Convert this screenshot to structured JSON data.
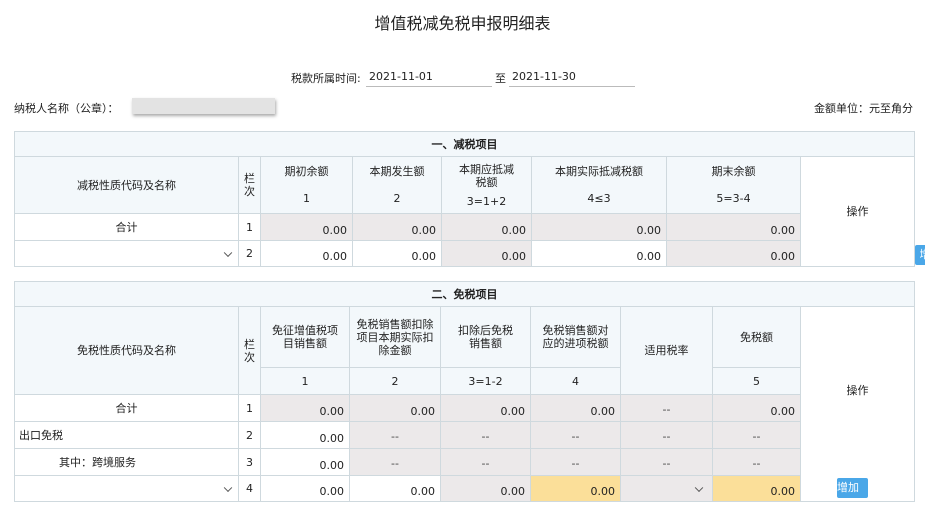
{
  "title": "增值税减免税申报明细表",
  "period": {
    "label": "税款所属时间:",
    "from": "2021-11-01",
    "to_label": "至",
    "to": "2021-11-30"
  },
  "taxpayer_label": "纳税人名称（公章）：",
  "unit": "金额单位：元至角分",
  "section1": {
    "title": "一、减税项目",
    "col_name": "减税性质代码及名称",
    "col_row": "栏次",
    "cols": [
      {
        "label": "期初余额",
        "formula": "1"
      },
      {
        "label": "本期发生额",
        "formula": "2"
      },
      {
        "label": "本期应抵减税额",
        "formula": "3=1+2"
      },
      {
        "label": "本期实际抵减税额",
        "formula": "4≤3"
      },
      {
        "label": "期末余额",
        "formula": "5=3-4"
      }
    ],
    "col_op": "操作",
    "rows": [
      {
        "name": "合计",
        "no": "1",
        "v": [
          "0.00",
          "0.00",
          "0.00",
          "0.00",
          "0.00"
        ]
      },
      {
        "name": "",
        "no": "2",
        "v": [
          "0.00",
          "0.00",
          "0.00",
          "0.00",
          "0.00"
        ]
      }
    ],
    "add_btn": "增加"
  },
  "section2": {
    "title": "二、免税项目",
    "col_name": "免税性质代码及名称",
    "col_row": "栏次",
    "cols": [
      {
        "label": "免征增值税项目销售额",
        "formula": "1"
      },
      {
        "label": "免税销售额扣除项目本期实际扣除金额",
        "formula": "2"
      },
      {
        "label": "扣除后免税销售额",
        "formula": "3=1-2"
      },
      {
        "label": "免税销售额对应的进项税额",
        "formula": "4"
      },
      {
        "label": "适用税率",
        "formula": ""
      },
      {
        "label": "免税额",
        "formula": "5"
      }
    ],
    "col_op": "操作",
    "rows": [
      {
        "name": "合计",
        "no": "1",
        "v": [
          "0.00",
          "0.00",
          "0.00",
          "0.00",
          "--",
          "0.00"
        ]
      },
      {
        "name": "出口免税",
        "no": "2",
        "v": [
          "0.00",
          "--",
          "--",
          "--",
          "--",
          "--"
        ]
      },
      {
        "name": "其中：跨境服务",
        "no": "3",
        "v": [
          "0.00",
          "--",
          "--",
          "--",
          "--",
          "--"
        ]
      },
      {
        "name": "",
        "no": "4",
        "v": [
          "0.00",
          "0.00",
          "0.00",
          "0.00",
          "",
          "0.00"
        ]
      }
    ],
    "add_btn": "增加"
  }
}
